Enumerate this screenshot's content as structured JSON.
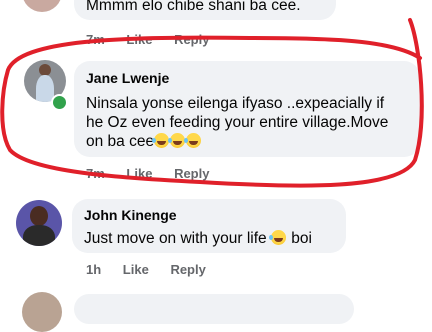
{
  "comments": [
    {
      "text": "Mmmm elo chibe shani ba cee.",
      "time": "7m",
      "like": "Like",
      "reply": "Reply"
    },
    {
      "name": "Jane Lwenje",
      "text_line1": "Ninsala yonse eilenga ifyaso ..expeacially if",
      "text_line2": "he Oz even feeding your entire village.Move",
      "text_line3": "on ba cee",
      "time": "7m",
      "like": "Like",
      "reply": "Reply"
    },
    {
      "name": "John Kinenge",
      "text_before": "Just move on with your life",
      "text_after": "boi",
      "time": "1h",
      "like": "Like",
      "reply": "Reply"
    }
  ],
  "colors": {
    "highlight": "#e0202a",
    "bubble": "#f0f2f5",
    "meta": "#65676b",
    "online": "#31a24c"
  }
}
